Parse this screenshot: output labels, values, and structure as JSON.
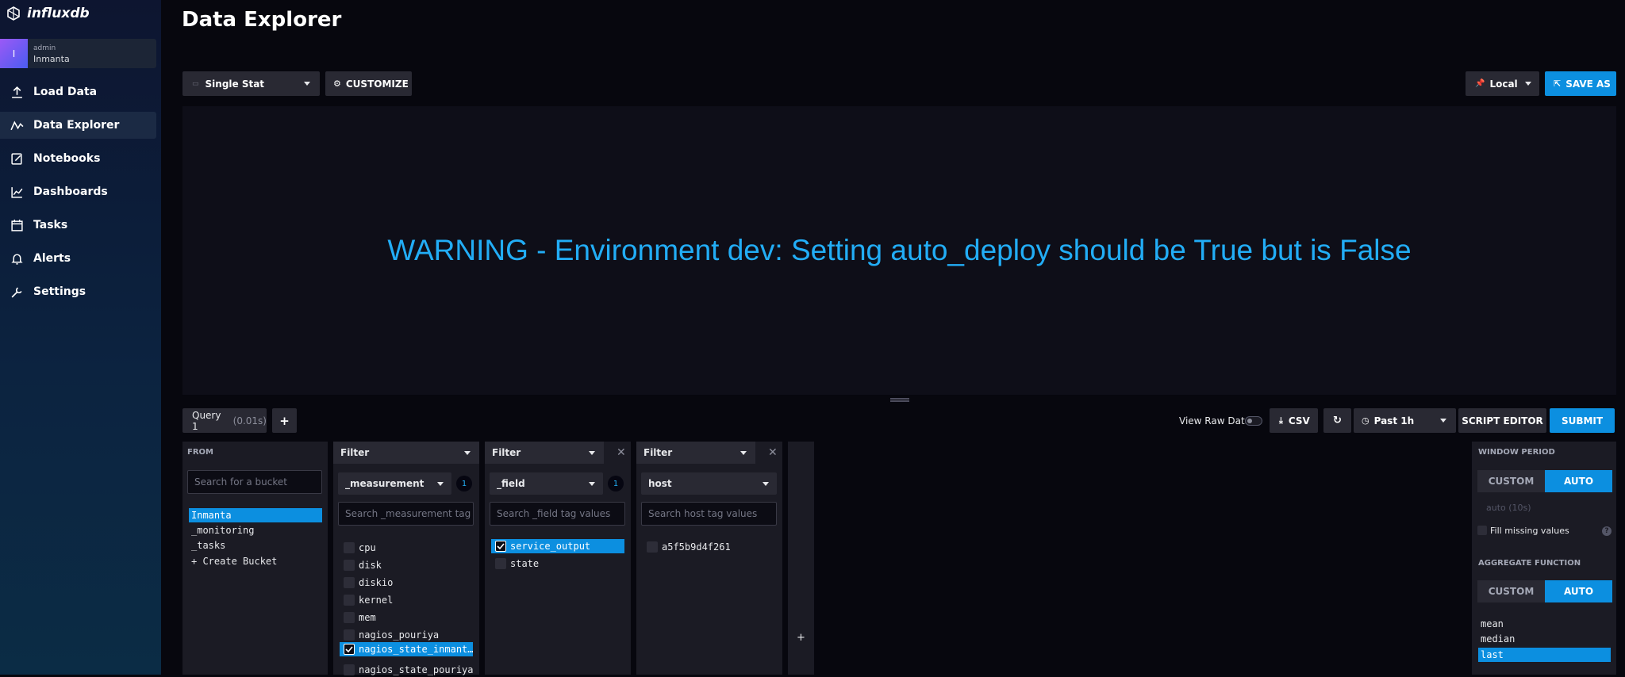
{
  "app": {
    "logo_text": "influxdb"
  },
  "org": {
    "avatar_letter": "I",
    "user": "admin",
    "name": "Inmanta"
  },
  "nav": {
    "items": [
      {
        "label": "Load Data",
        "icon": "upload-icon"
      },
      {
        "label": "Data Explorer",
        "icon": "graph-icon"
      },
      {
        "label": "Notebooks",
        "icon": "notebook-icon"
      },
      {
        "label": "Dashboards",
        "icon": "dashboard-icon"
      },
      {
        "label": "Tasks",
        "icon": "calendar-icon"
      },
      {
        "label": "Alerts",
        "icon": "bell-icon"
      },
      {
        "label": "Settings",
        "icon": "wrench-icon"
      }
    ]
  },
  "header": {
    "title": "Data Explorer"
  },
  "toolbar": {
    "viz_type": "Single Stat",
    "customize": "CUSTOMIZE",
    "timezone": "Local",
    "save_as": "SAVE AS"
  },
  "visualization": {
    "message": "WARNING - Environment dev: Setting auto_deploy should be True but is False"
  },
  "query": {
    "tab_label": "Query 1",
    "tab_time": "(0.01s)",
    "add": "+",
    "view_raw": "View Raw Data",
    "csv": "CSV",
    "time_range": "Past 1h",
    "script_editor": "SCRIPT EDITOR",
    "submit": "SUBMIT"
  },
  "from": {
    "label": "FROM",
    "search_placeholder": "Search for a bucket",
    "buckets": [
      "Inmanta",
      "_monitoring",
      "_tasks",
      "+ Create Bucket"
    ],
    "selected": "Inmanta"
  },
  "filters": [
    {
      "label": "Filter",
      "key": "_measurement",
      "count": "1",
      "search_placeholder": "Search _measurement tag",
      "values": [
        {
          "label": "cpu",
          "checked": false
        },
        {
          "label": "disk",
          "checked": false
        },
        {
          "label": "diskio",
          "checked": false
        },
        {
          "label": "kernel",
          "checked": false
        },
        {
          "label": "mem",
          "checked": false
        },
        {
          "label": "nagios_pouriya",
          "checked": false
        },
        {
          "label": "nagios_state_inmant…",
          "checked": true
        },
        {
          "label": "nagios_state_pouriya",
          "checked": false
        }
      ]
    },
    {
      "label": "Filter",
      "key": "_field",
      "count": "1",
      "search_placeholder": "Search _field tag values",
      "values": [
        {
          "label": "service_output",
          "checked": true
        },
        {
          "label": "state",
          "checked": false
        }
      ]
    },
    {
      "label": "Filter",
      "key": "host",
      "search_placeholder": "Search host tag values",
      "values": [
        {
          "label": "a5f5b9d4f261",
          "checked": false
        }
      ]
    }
  ],
  "add_filter": "+",
  "aggregate": {
    "window_period_label": "WINDOW PERIOD",
    "custom": "CUSTOM",
    "auto": "AUTO",
    "window_placeholder": "auto (10s)",
    "fill_missing": "Fill missing values",
    "function_label": "AGGREGATE FUNCTION",
    "functions": [
      "mean",
      "median",
      "last"
    ],
    "selected": "last"
  }
}
